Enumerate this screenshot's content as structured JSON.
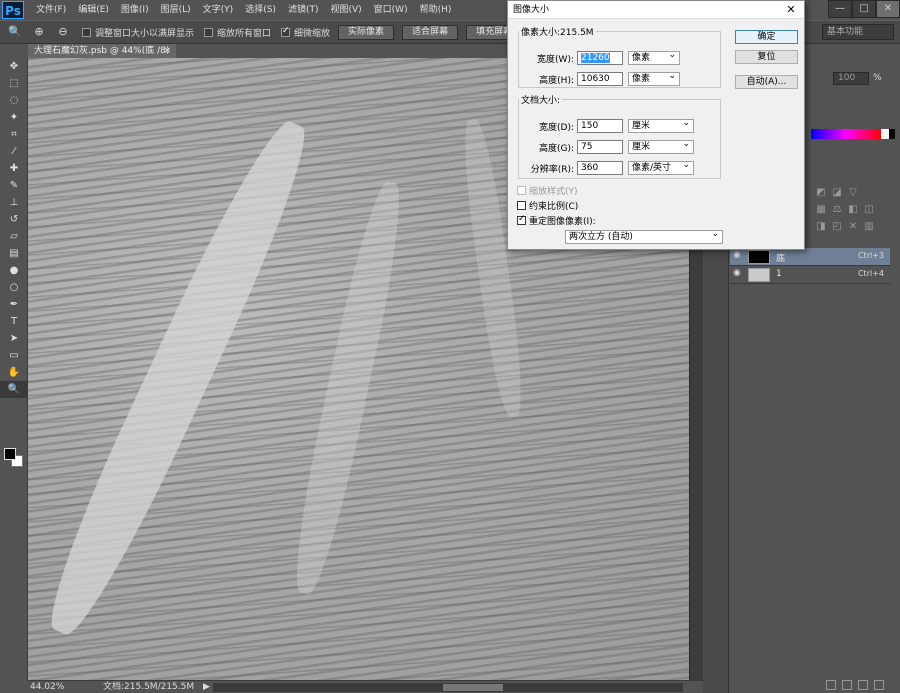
{
  "app": {
    "logo": "Ps",
    "menus": [
      "文件(F)",
      "编辑(E)",
      "图像(I)",
      "图层(L)",
      "文字(Y)",
      "选择(S)",
      "滤镜(T)",
      "视图(V)",
      "窗口(W)",
      "帮助(H)"
    ],
    "window_controls": [
      "—",
      "□",
      "✕"
    ]
  },
  "options_bar": {
    "resize_windows_label": "调整窗口大小以满屏显示",
    "zoom_all_label": "缩放所有窗口",
    "scrubby_zoom_label": "细微缩放",
    "actual_pixels": "实际像素",
    "fit_screen": "适合屏幕",
    "fill_screen": "填充屏幕",
    "workspace": "基本功能"
  },
  "document": {
    "tab_title": "大理石魔幻灰.psb @ 44%(底 /8)",
    "tab_close": "×"
  },
  "status_bar": {
    "zoom": "44.02%",
    "doc_info": "文档:215.5M/215.5M",
    "arrow": "▶"
  },
  "layers": [
    {
      "name": "底",
      "shortcut": "Ctrl+3",
      "selected": true,
      "thumb_color": "#000000"
    },
    {
      "name": "1",
      "shortcut": "Ctrl+4",
      "selected": false,
      "thumb_color": "#c9c9c9"
    }
  ],
  "right_panel": {
    "opacity_value": "100",
    "percent": "%"
  },
  "dialog": {
    "title": "图像大小",
    "close": "✕",
    "pixel_dimensions_label": "像素大小:215.5M",
    "width_label": "宽度(W):",
    "width_value": "21260",
    "width_unit": "像素",
    "height_label": "高度(H):",
    "height_value": "10630",
    "height_unit": "像素",
    "doc_size_label": "文档大小:",
    "doc_width_label": "宽度(D):",
    "doc_width_value": "150",
    "doc_width_unit": "厘米",
    "doc_height_label": "高度(G):",
    "doc_height_value": "75",
    "doc_height_unit": "厘米",
    "resolution_label": "分辨率(R):",
    "resolution_value": "360",
    "resolution_unit": "像素/英寸",
    "ok": "确定",
    "reset": "复位",
    "auto": "自动(A)...",
    "scale_styles": "缩放样式(Y)",
    "constrain": "约束比例(C)",
    "resample": "重定图像像素(I):",
    "resample_method": "两次立方 (自动)"
  },
  "colors": {
    "accent": "#31a8ff",
    "selected_layer": "#6f7f95",
    "selection_highlight": "#3399ff"
  }
}
